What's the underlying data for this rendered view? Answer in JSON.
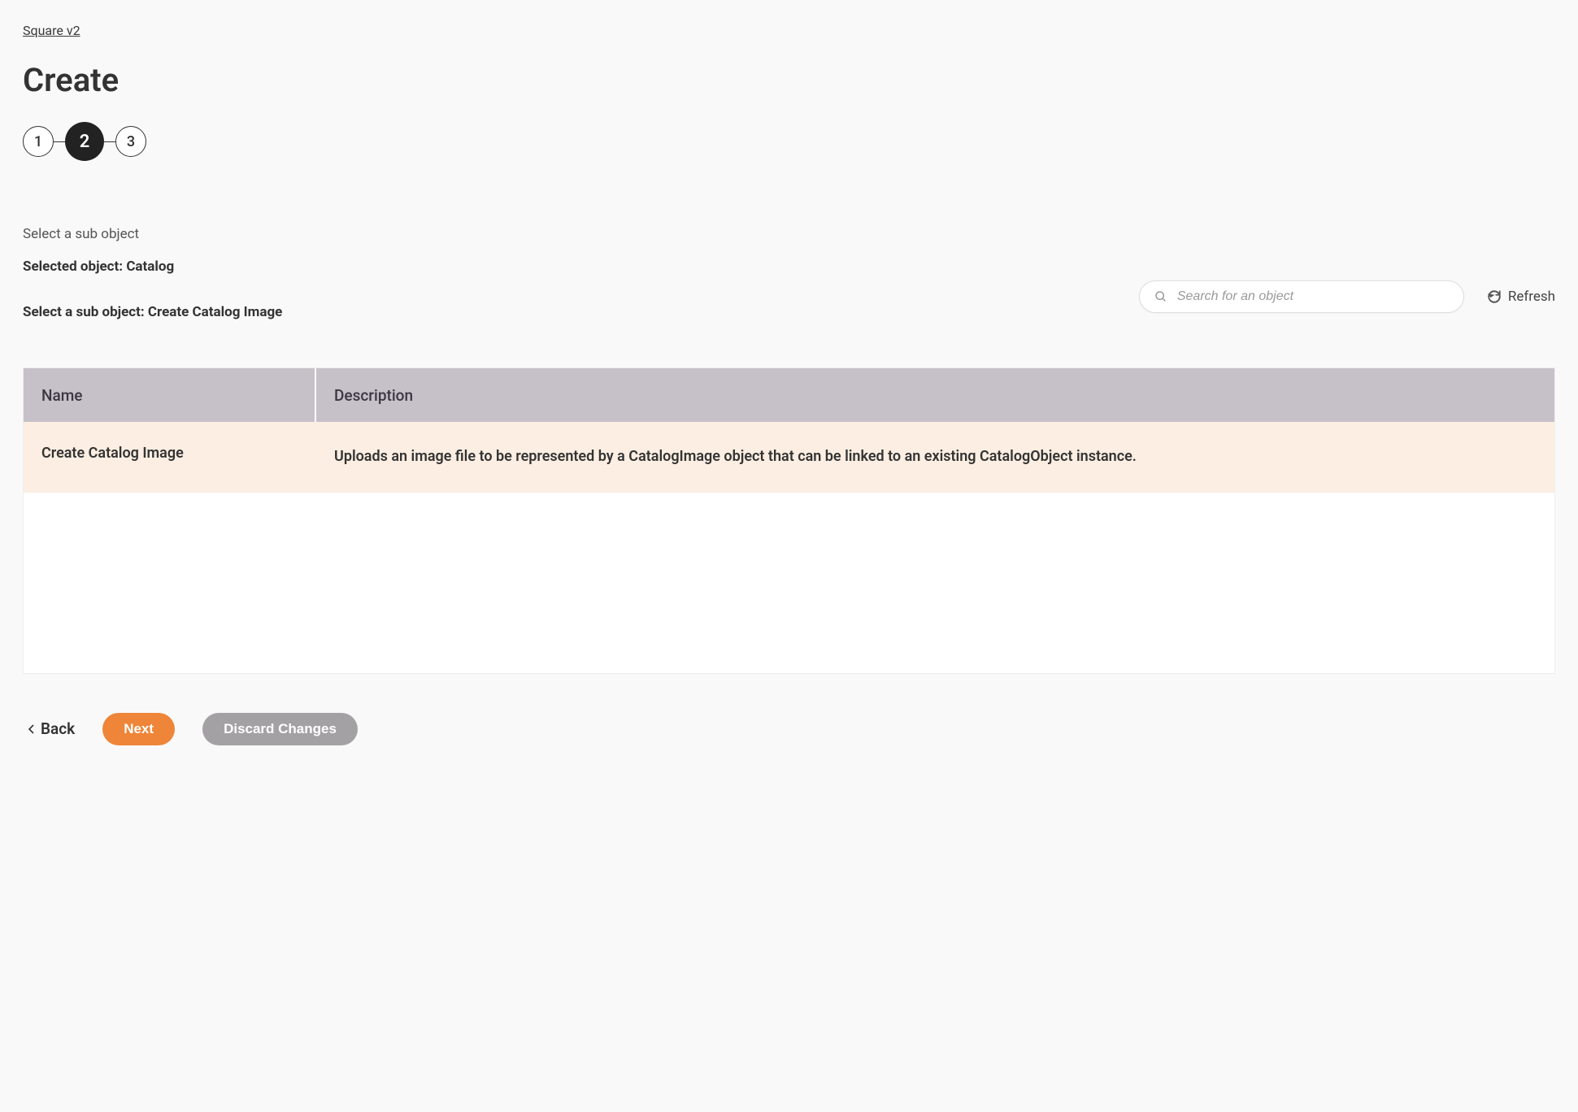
{
  "breadcrumb": {
    "label": "Square v2"
  },
  "page": {
    "title": "Create"
  },
  "stepper": {
    "steps": [
      "1",
      "2",
      "3"
    ],
    "active_index": 1
  },
  "section": {
    "label": "Select a sub object",
    "selected_prefix": "Selected object: ",
    "selected_value": "Catalog",
    "subobject_prefix": "Select a sub object: ",
    "subobject_value": "Create Catalog Image"
  },
  "search": {
    "placeholder": "Search for an object"
  },
  "refresh": {
    "label": "Refresh"
  },
  "table": {
    "headers": {
      "name": "Name",
      "description": "Description"
    },
    "rows": [
      {
        "name": "Create Catalog Image",
        "description": "Uploads an image file to be represented by a CatalogImage object that can be linked to an existing CatalogObject instance."
      }
    ]
  },
  "buttons": {
    "back": "Back",
    "next": "Next",
    "discard": "Discard Changes"
  }
}
